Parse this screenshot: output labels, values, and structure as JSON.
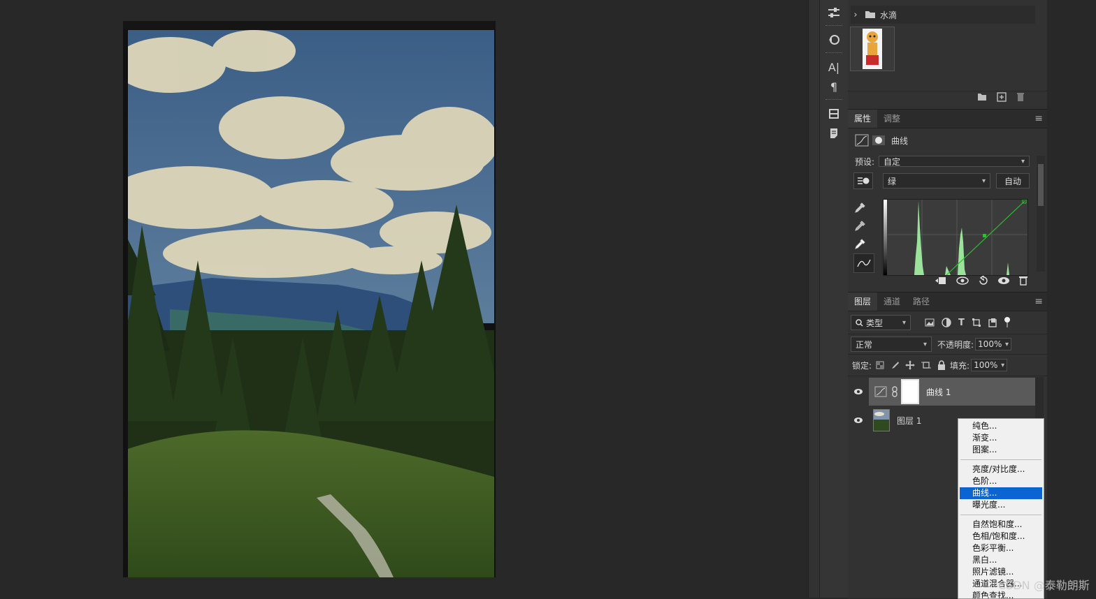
{
  "layers_group": {
    "name": "水滴"
  },
  "properties": {
    "tabs": [
      "属性",
      "调整"
    ],
    "type_label": "曲线",
    "preset_label": "预设:",
    "preset_value": "自定",
    "channel_value": "绿",
    "auto_label": "自动"
  },
  "layers": {
    "tabs": [
      "图层",
      "通道",
      "路径"
    ],
    "filter_value": "类型",
    "blend_mode": "正常",
    "opacity_label": "不透明度:",
    "opacity_value": "100%",
    "lock_label": "锁定:",
    "fill_label": "填充:",
    "fill_value": "100%",
    "items": [
      {
        "name": "曲线 1"
      },
      {
        "name": "图层 1"
      }
    ]
  },
  "context_menu": {
    "group1": [
      "纯色...",
      "渐变...",
      "图案..."
    ],
    "group2": [
      "亮度/对比度...",
      "色阶...",
      "曲线...",
      "曝光度..."
    ],
    "group3": [
      "自然饱和度...",
      "色相/饱和度...",
      "色彩平衡...",
      "黑白...",
      "照片滤镜...",
      "通道混合器...",
      "颜色查找..."
    ],
    "selected": "曲线..."
  },
  "watermark": "CSDN @泰勒朗斯",
  "colors": {
    "accent": "#0a64d2",
    "curve": "#2cc02c",
    "histogram": "#9be29b"
  }
}
